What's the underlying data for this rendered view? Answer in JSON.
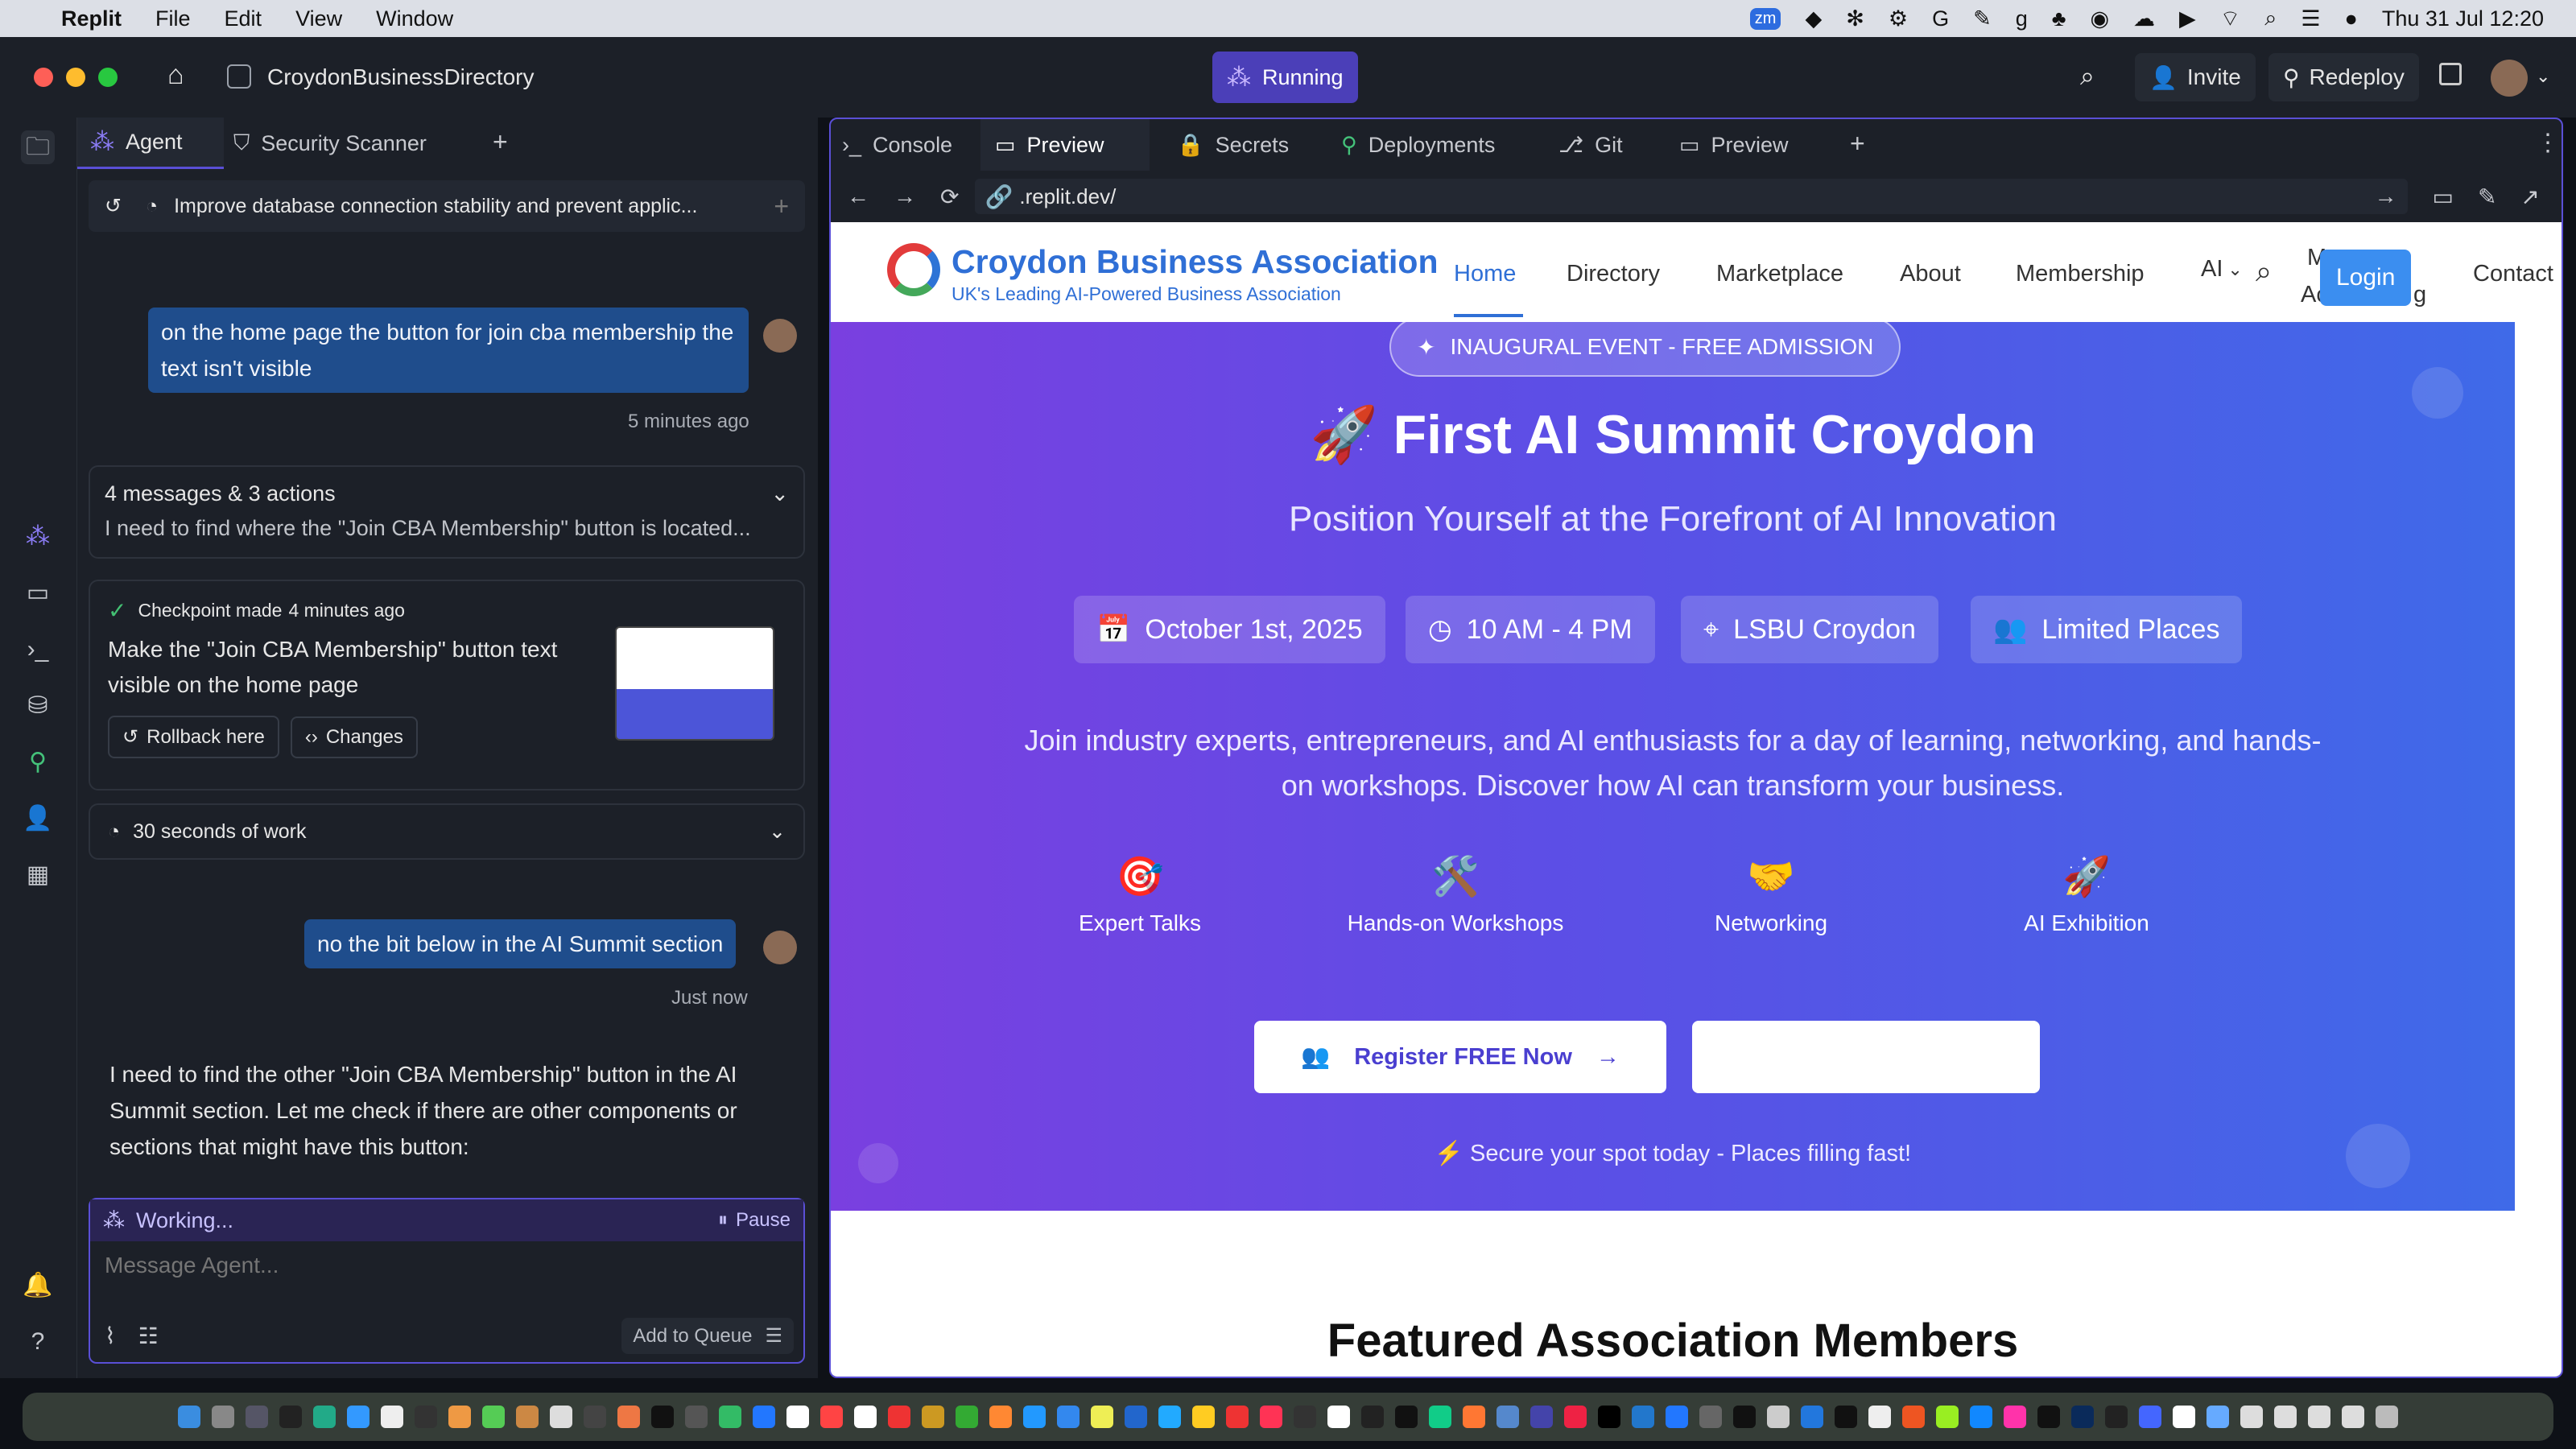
{
  "menubar": {
    "app": "Replit",
    "items": [
      "File",
      "Edit",
      "View",
      "Window"
    ],
    "clock": "Thu 31 Jul  12:20"
  },
  "titlebar": {
    "project": "CroydonBusinessDirectory",
    "status": "Running",
    "invite": "Invite",
    "redeploy": "Redeploy"
  },
  "agent_tabs": [
    {
      "label": "Agent"
    },
    {
      "label": "Security Scanner"
    }
  ],
  "agent": {
    "task_title": "Improve database connection stability and prevent applic...",
    "msg1": "on the home page the button for join cba membership the text isn't visible",
    "msg1_time": "5 minutes ago",
    "summary_title": "4 messages & 3 actions",
    "summary_text": "I need to find where the \"Join CBA Membership\" button is located...",
    "checkpoint_label": "Checkpoint made",
    "checkpoint_time": "4 minutes ago",
    "checkpoint_text": "Make the \"Join CBA Membership\" button text visible on the home page",
    "rollback": "Rollback here",
    "changes": "Changes",
    "work_label": "30 seconds of work",
    "msg2": "no the bit below in the AI Summit section",
    "msg2_time": "Just now",
    "reply": "I need to find the other \"Join CBA Membership\" button in the AI Summit section. Let me check if there are other components or sections that might have this button:",
    "working": "Working...",
    "pause": "Pause",
    "input_placeholder": "Message Agent...",
    "queue": "Add to Queue"
  },
  "right_tabs": [
    {
      "label": "Console"
    },
    {
      "label": "Preview"
    },
    {
      "label": "Secrets"
    },
    {
      "label": "Deployments"
    },
    {
      "label": "Git"
    },
    {
      "label": "Preview"
    }
  ],
  "url": ".replit.dev/",
  "site": {
    "brand": "Croydon Business Association",
    "tagline": "UK's Leading AI-Powered Business Association",
    "nav": [
      "Home",
      "Directory",
      "Marketplace",
      "About",
      "Membership",
      "AI"
    ],
    "nav_overflow_top": "M",
    "nav_overflow_bottom": "Ac",
    "nav_overflow_right": "g",
    "login": "Login",
    "contact": "Contact",
    "badge": "INAUGURAL EVENT - FREE ADMISSION",
    "title": "🚀 First AI Summit Croydon",
    "subtitle": "Position Yourself at the Forefront of AI Innovation",
    "chips": [
      {
        "label": "October 1st, 2025",
        "icon": "calendar-icon"
      },
      {
        "label": "10 AM - 4 PM",
        "icon": "clock-icon"
      },
      {
        "label": "LSBU Croydon",
        "icon": "map-pin-icon"
      },
      {
        "label": "Limited Places",
        "icon": "users-icon"
      }
    ],
    "description": "Join industry experts, entrepreneurs, and AI enthusiasts for a day of learning, networking, and hands-on workshops. Discover how AI can transform your business.",
    "features": [
      {
        "emoji": "🎯",
        "label": "Expert Talks"
      },
      {
        "emoji": "🛠️",
        "label": "Hands-on Workshops"
      },
      {
        "emoji": "🤝",
        "label": "Networking"
      },
      {
        "emoji": "🚀",
        "label": "AI Exhibition"
      }
    ],
    "register": "Register FREE Now",
    "secure": "⚡ Secure your spot today - Places filling fast!",
    "featured": "Featured Association Members"
  },
  "colors": {
    "accent": "#5a4fd6",
    "brand": "#2f6fd6",
    "bubble": "#1f4d8c"
  }
}
